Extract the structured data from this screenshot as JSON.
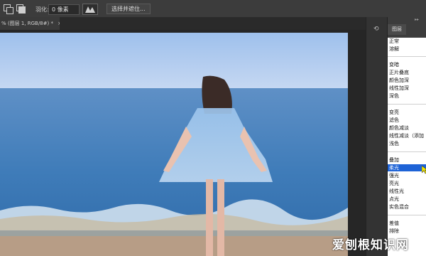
{
  "options_bar": {
    "feather_label": "羽化:",
    "feather_value": "0 像素",
    "select_mask_button": "选择并遮住..."
  },
  "document_tab": {
    "title": "% (图层 1, RGB/8#) *",
    "close": "×"
  },
  "panel": {
    "tab_label": "图层",
    "collapse_glyph": "▸▸"
  },
  "blend_modes": {
    "group1": [
      "正常",
      "溶解"
    ],
    "group2": [
      "变暗",
      "正片叠底",
      "颜色加深",
      "线性加深",
      "深色"
    ],
    "group3": [
      "变亮",
      "滤色",
      "颜色减淡",
      "线性减淡（添加",
      "浅色"
    ],
    "group4": [
      "叠加",
      "柔光",
      "强光",
      "亮光",
      "线性光",
      "点光",
      "实色混合"
    ],
    "group5": [
      "差值",
      "排除"
    ],
    "selected": "柔光"
  },
  "watermark": "爱刨根知识网",
  "colors": {
    "selection": "#1e63d6",
    "sky": "#a9c8ef",
    "sea": "#3a78b6"
  }
}
